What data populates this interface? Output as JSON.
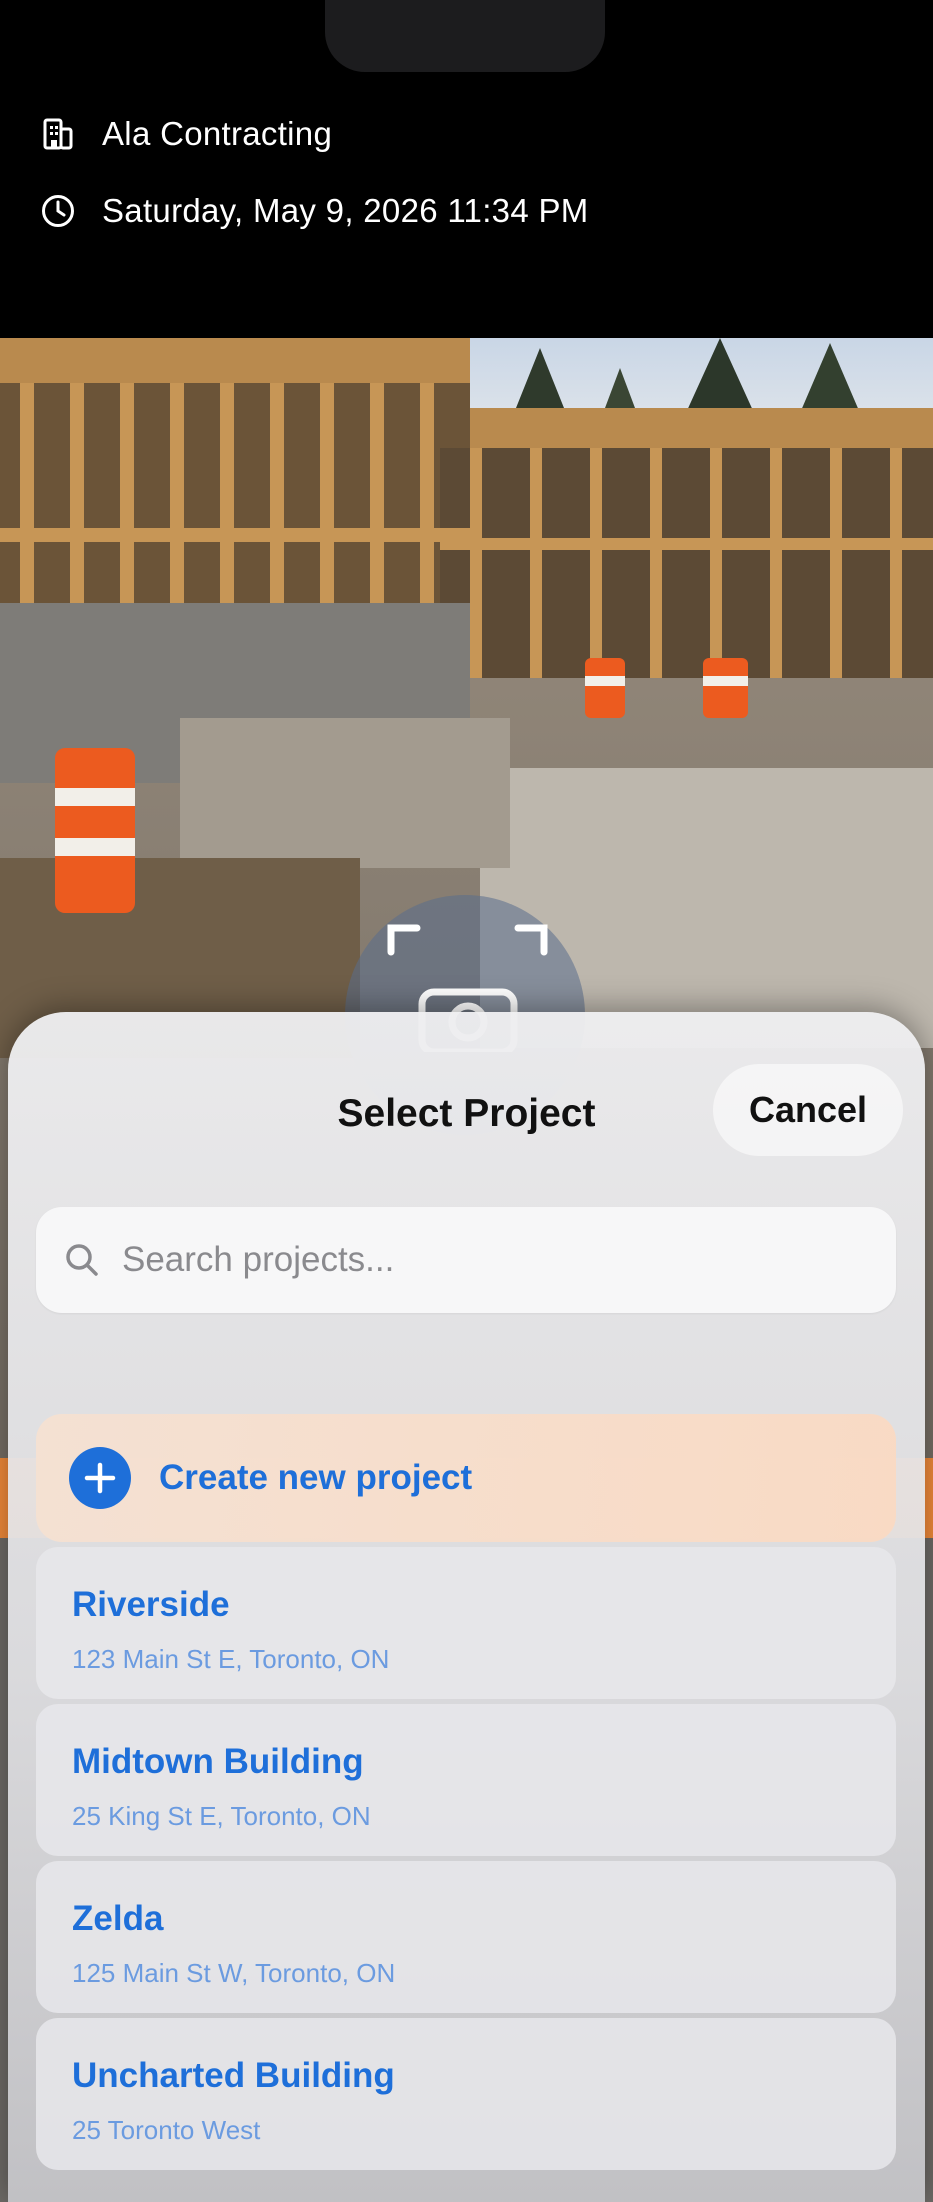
{
  "header": {
    "company": "Ala Contracting",
    "company_icon": "building-icon",
    "datetime": "Saturday, May 9, 2026 11:34 PM",
    "datetime_icon": "clock-icon"
  },
  "camera": {
    "shutter_icon": "camera-icon"
  },
  "sheet": {
    "title": "Select Project",
    "cancel_label": "Cancel",
    "search": {
      "placeholder": "Search projects...",
      "value": ""
    },
    "create_label": "Create new project",
    "projects": [
      {
        "name": "Riverside",
        "address": "123 Main St E, Toronto, ON"
      },
      {
        "name": "Midtown Building",
        "address": "25 King St E, Toronto, ON"
      },
      {
        "name": "Zelda",
        "address": "125 Main St W, Toronto, ON"
      },
      {
        "name": "Uncharted Building",
        "address": "25 Toronto West"
      }
    ]
  },
  "colors": {
    "accent": "#1e6fd9",
    "accent_light": "#6b9be0",
    "create_bg": "#f8dcc6"
  }
}
